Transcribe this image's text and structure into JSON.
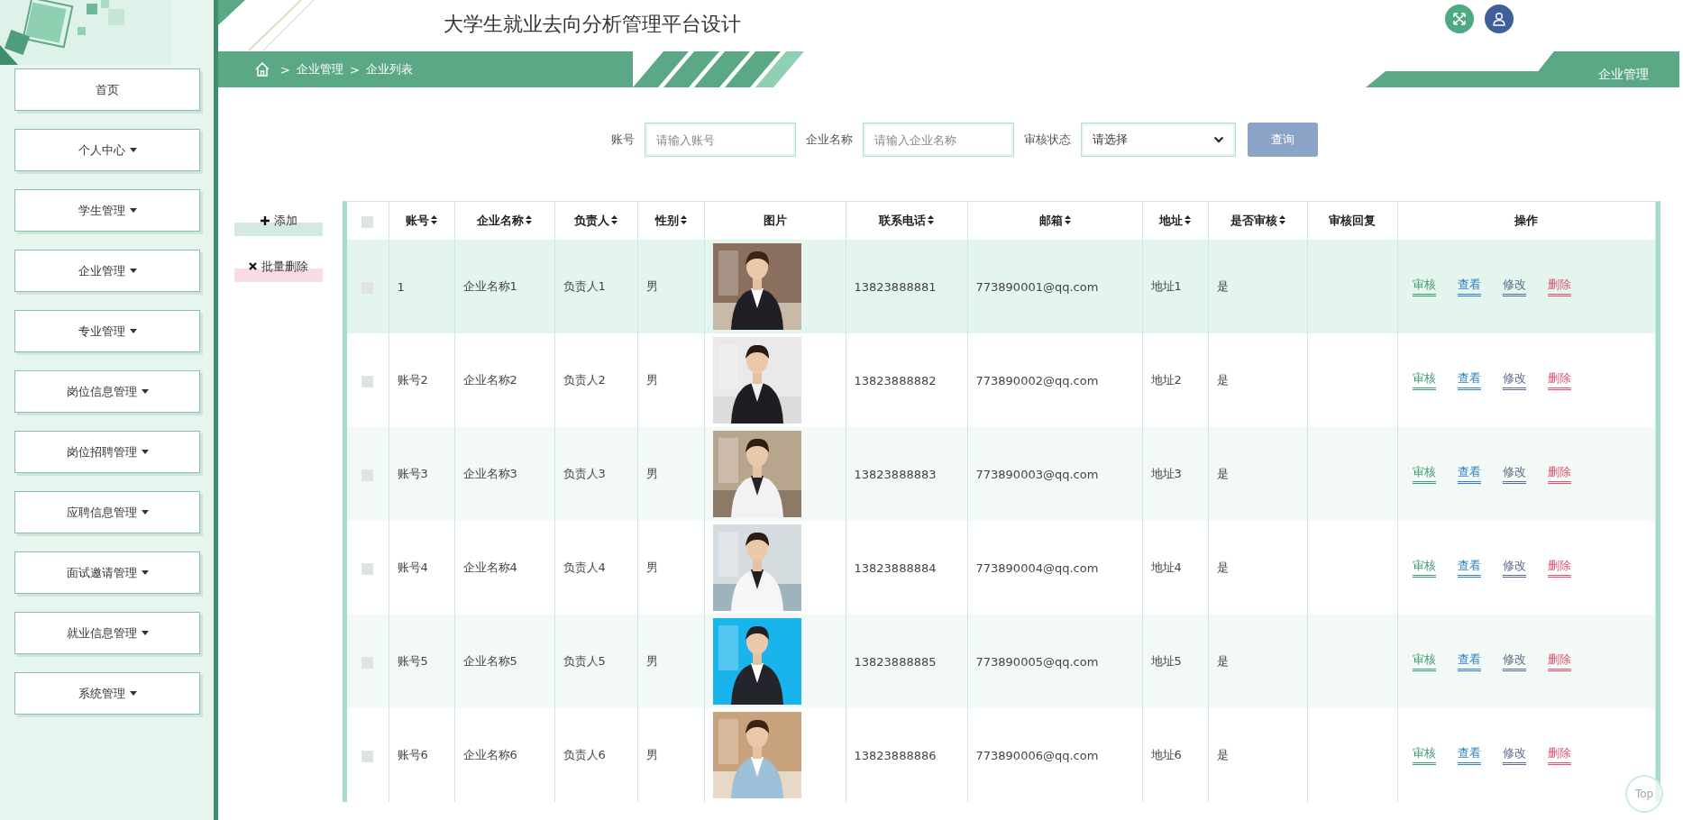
{
  "header": {
    "title": "大学生就业去向分析管理平台设计"
  },
  "breadcrumb": [
    {
      "separator": ">",
      "label": "企业管理"
    },
    {
      "separator": ">",
      "label": "企业列表"
    }
  ],
  "page_tab": "企业管理",
  "sidebar": {
    "items": [
      {
        "label": "首页",
        "expandable": false
      },
      {
        "label": "个人中心",
        "expandable": true
      },
      {
        "label": "学生管理",
        "expandable": true
      },
      {
        "label": "企业管理",
        "expandable": true
      },
      {
        "label": "专业管理",
        "expandable": true
      },
      {
        "label": "岗位信息管理",
        "expandable": true
      },
      {
        "label": "岗位招聘管理",
        "expandable": true
      },
      {
        "label": "应聘信息管理",
        "expandable": true
      },
      {
        "label": "面试邀请管理",
        "expandable": true
      },
      {
        "label": "就业信息管理",
        "expandable": true
      },
      {
        "label": "系统管理",
        "expandable": true
      }
    ]
  },
  "search": {
    "fields": [
      {
        "kind": "input",
        "label": "账号",
        "placeholder": "请输入账号"
      },
      {
        "kind": "input",
        "label": "企业名称",
        "placeholder": "请输入企业名称"
      },
      {
        "kind": "select",
        "label": "审核状态",
        "value": "请选择"
      }
    ],
    "button": "查询"
  },
  "actions": [
    {
      "kind": "add",
      "label": "添加"
    },
    {
      "kind": "delete",
      "label": "批量删除"
    }
  ],
  "table": {
    "columns": [
      {
        "kind": "checkbox",
        "checked": false
      },
      {
        "label": "账号",
        "kind": "text",
        "sortable": true
      },
      {
        "label": "企业名称",
        "kind": "text",
        "sortable": true
      },
      {
        "label": "负责人",
        "kind": "text",
        "sortable": true
      },
      {
        "label": "性别",
        "kind": "text",
        "sortable": true
      },
      {
        "label": "图片",
        "kind": "picture",
        "sortable": false
      },
      {
        "label": "联系电话",
        "kind": "text",
        "sortable": true
      },
      {
        "label": "邮箱",
        "kind": "text",
        "sortable": true
      },
      {
        "label": "地址",
        "kind": "text",
        "sortable": true
      },
      {
        "label": "是否审核",
        "kind": "text",
        "sortable": true
      },
      {
        "label": "审核回复",
        "kind": "text",
        "sortable": false
      },
      {
        "label": "操作",
        "kind": "actions",
        "sortable": false
      }
    ],
    "rows": [
      {
        "highlighted": true,
        "cells": [
          {
            "checked": false
          },
          "1",
          "企业名称1",
          "负责人1",
          "男",
          {
            "kind": "picture"
          },
          "13823888881",
          "773890001@qq.com",
          "地址1",
          "是",
          "",
          {
            "actions": [
              {
                "kind": "audit",
                "label": "审核"
              },
              {
                "kind": "view",
                "label": "查看"
              },
              {
                "kind": "edit",
                "label": "修改"
              },
              {
                "kind": "delete",
                "label": "删除"
              }
            ]
          }
        ]
      },
      {
        "highlighted": false,
        "cells": [
          {
            "checked": false
          },
          "账号2",
          "企业名称2",
          "负责人2",
          "男",
          {
            "kind": "picture"
          },
          "13823888882",
          "773890002@qq.com",
          "地址2",
          "是",
          "",
          {
            "actions": [
              {
                "kind": "audit",
                "label": "审核"
              },
              {
                "kind": "view",
                "label": "查看"
              },
              {
                "kind": "edit",
                "label": "修改"
              },
              {
                "kind": "delete",
                "label": "删除"
              }
            ]
          }
        ]
      },
      {
        "highlighted": false,
        "cells": [
          {
            "checked": false
          },
          "账号3",
          "企业名称3",
          "负责人3",
          "男",
          {
            "kind": "picture"
          },
          "13823888883",
          "773890003@qq.com",
          "地址3",
          "是",
          "",
          {
            "actions": [
              {
                "kind": "audit",
                "label": "审核"
              },
              {
                "kind": "view",
                "label": "查看"
              },
              {
                "kind": "edit",
                "label": "修改"
              },
              {
                "kind": "delete",
                "label": "删除"
              }
            ]
          }
        ]
      },
      {
        "highlighted": false,
        "cells": [
          {
            "checked": false
          },
          "账号4",
          "企业名称4",
          "负责人4",
          "男",
          {
            "kind": "picture"
          },
          "13823888884",
          "773890004@qq.com",
          "地址4",
          "是",
          "",
          {
            "actions": [
              {
                "kind": "audit",
                "label": "审核"
              },
              {
                "kind": "view",
                "label": "查看"
              },
              {
                "kind": "edit",
                "label": "修改"
              },
              {
                "kind": "delete",
                "label": "删除"
              }
            ]
          }
        ]
      },
      {
        "highlighted": false,
        "cells": [
          {
            "checked": false
          },
          "账号5",
          "企业名称5",
          "负责人5",
          "男",
          {
            "kind": "picture"
          },
          "13823888885",
          "773890005@qq.com",
          "地址5",
          "是",
          "",
          {
            "actions": [
              {
                "kind": "audit",
                "label": "审核"
              },
              {
                "kind": "view",
                "label": "查看"
              },
              {
                "kind": "edit",
                "label": "修改"
              },
              {
                "kind": "delete",
                "label": "删除"
              }
            ]
          }
        ]
      },
      {
        "highlighted": false,
        "cells": [
          {
            "checked": false
          },
          "账号6",
          "企业名称6",
          "负责人6",
          "男",
          {
            "kind": "picture"
          },
          "13823888886",
          "773890006@qq.com",
          "地址6",
          "是",
          "",
          {
            "actions": [
              {
                "kind": "audit",
                "label": "审核"
              },
              {
                "kind": "view",
                "label": "查看"
              },
              {
                "kind": "edit",
                "label": "修改"
              },
              {
                "kind": "delete",
                "label": "删除"
              }
            ]
          }
        ]
      }
    ]
  },
  "back_to_top": "Top"
}
